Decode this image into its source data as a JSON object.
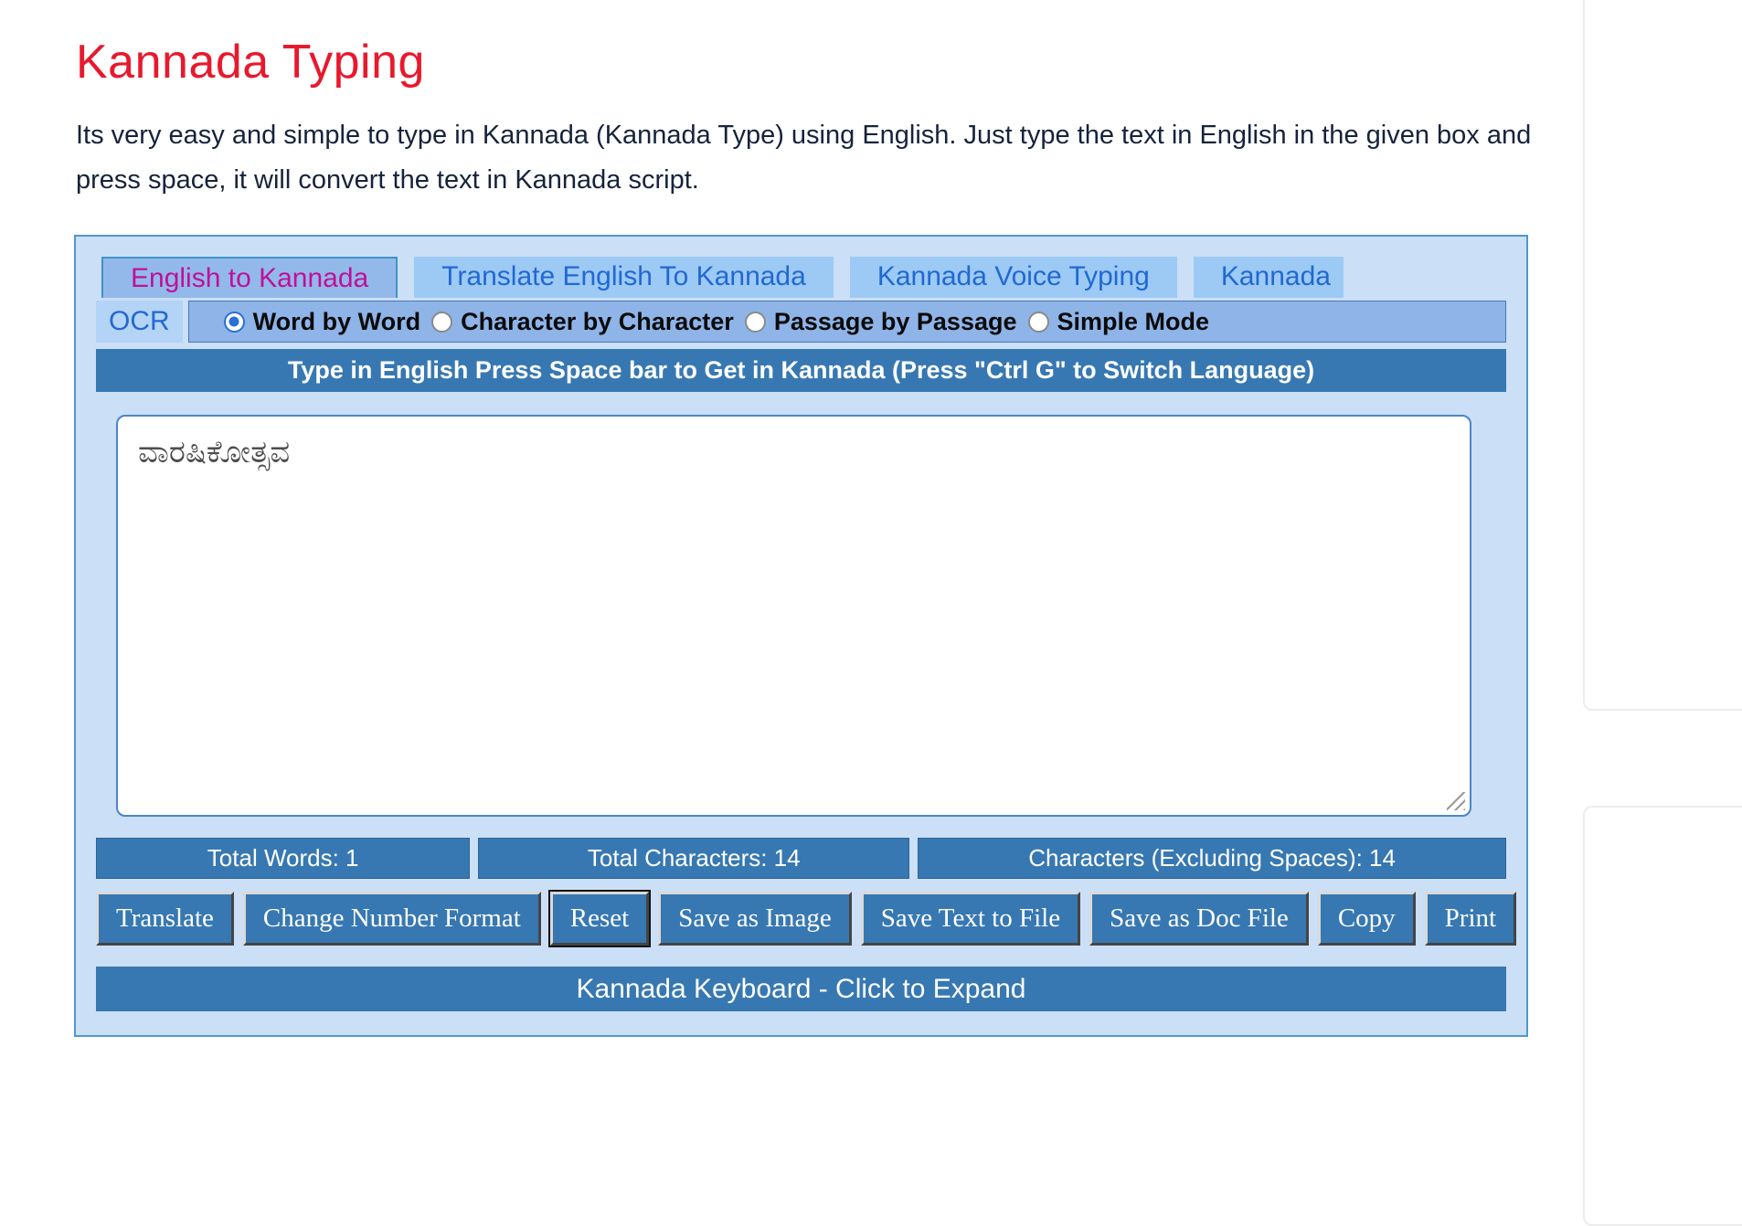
{
  "page": {
    "title": "Kannada Typing",
    "description": "Its very easy and simple to type in Kannada (Kannada Type) using English. Just type the text in English in the given box and press space, it will convert the text in Kannada script."
  },
  "colors": {
    "heading_red": "#e8192d",
    "steel_blue": "#3778b2",
    "panel_bg": "#cbdff7",
    "panel_border": "#4f97d2",
    "active_tab_bg": "#93b9ea",
    "active_tab_text": "#c0109a",
    "inactive_tab_bg": "#9ccaf5",
    "inactive_tab_text": "#2268d2",
    "mode_bar_bg": "#8eb4e8"
  },
  "tabs": [
    {
      "label": "English to Kannada",
      "active": true
    },
    {
      "label": "Translate English To Kannada",
      "active": false
    },
    {
      "label": "Kannada Voice Typing",
      "active": false
    },
    {
      "label": "Kannada OCR",
      "active": false,
      "wrap_line1": "Kannada",
      "wrap_line2": "OCR"
    }
  ],
  "modes": [
    {
      "label": "Word by Word",
      "selected": true
    },
    {
      "label": "Character by Character",
      "selected": false
    },
    {
      "label": "Passage by Passage",
      "selected": false
    },
    {
      "label": "Simple Mode",
      "selected": false
    }
  ],
  "editor": {
    "instruction": "Type in English Press Space bar to Get in Kannada (Press \"Ctrl G\" to Switch Language)",
    "text": "ವಾರಷಿಕೋತ್ಸವ"
  },
  "stats": [
    {
      "label": "Total Words: 1"
    },
    {
      "label": "Total Characters: 14"
    },
    {
      "label": "Characters (Excluding Spaces): 14"
    }
  ],
  "buttons": [
    "Translate",
    "Change Number Format",
    "Reset",
    "Save as Image",
    "Save Text to File",
    "Save as Doc File",
    "Copy",
    "Print"
  ],
  "keyboard_bar": "Kannada Keyboard - Click to Expand"
}
